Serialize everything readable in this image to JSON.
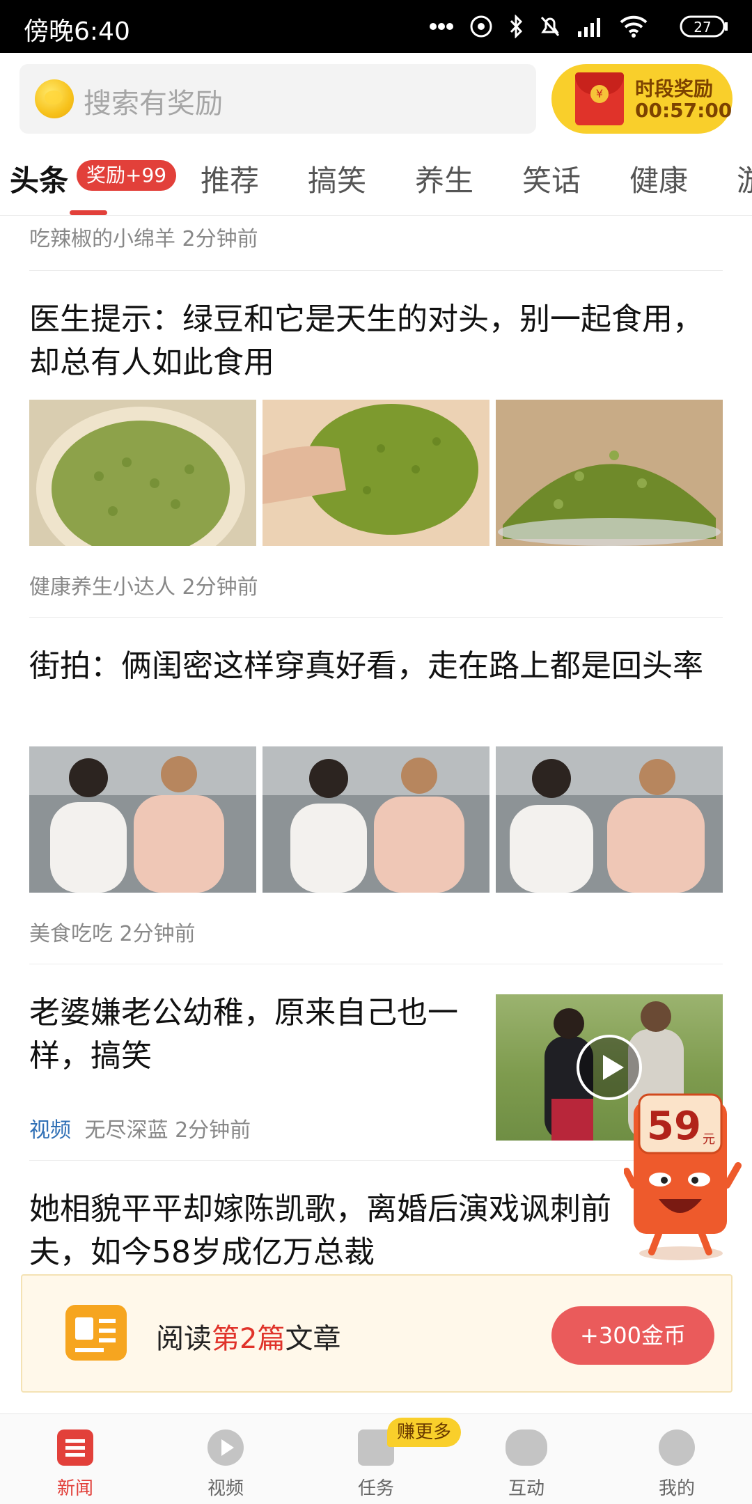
{
  "status_bar": {
    "time": "傍晚6:40",
    "battery": "27"
  },
  "header": {
    "search_placeholder": "搜索有奖励",
    "reward": {
      "title": "时段奖励",
      "timer": "00:57:00"
    }
  },
  "tabs": [
    {
      "label": "头条",
      "badge": "奖励+99",
      "active": true
    },
    {
      "label": "推荐"
    },
    {
      "label": "搞笑"
    },
    {
      "label": "养生"
    },
    {
      "label": "笑话"
    },
    {
      "label": "健康"
    },
    {
      "label": "游"
    }
  ],
  "feed": [
    {
      "source": "吃辣椒的小绵羊",
      "time": "2分钟前"
    },
    {
      "title": "医生提示：绿豆和它是天生的对头，别一起食用，却总有人如此食用",
      "images": [
        "mung-bean-bowl",
        "mung-bean-hand",
        "mung-bean-glass"
      ],
      "source": "健康养生小达人",
      "time": "2分钟前"
    },
    {
      "title": "街拍：俩闺密这样穿真好看，走在路上都是回头率",
      "images": [
        "street-photo-1",
        "street-photo-2",
        "street-photo-3"
      ],
      "source": "美食吃吃",
      "time": "2分钟前"
    },
    {
      "title": "老婆嫌老公幼稚，原来自己也一样，搞笑",
      "tag": "视频",
      "source": "无尽深蓝",
      "time": "2分钟前"
    },
    {
      "title": "她相貌平平却嫁陈凯歌，离婚后演戏讽刺前夫，如今58岁成亿万总裁"
    }
  ],
  "mascot": {
    "amount": "59",
    "unit": "元"
  },
  "read_task": {
    "prefix": "阅读",
    "highlight": "第2篇",
    "suffix": "文章",
    "button": "+300金币"
  },
  "bottom_nav": [
    {
      "label": "新闻",
      "icon": "news-icon",
      "active": true
    },
    {
      "label": "视频",
      "icon": "play-icon"
    },
    {
      "label": "任务",
      "icon": "gift-icon",
      "badge": "赚更多"
    },
    {
      "label": "互动",
      "icon": "gamepad-icon"
    },
    {
      "label": "我的",
      "icon": "user-icon"
    }
  ],
  "colors": {
    "accent": "#e2403a",
    "reward_yellow": "#f9cf2b",
    "video_tag": "#2f6fb5"
  }
}
